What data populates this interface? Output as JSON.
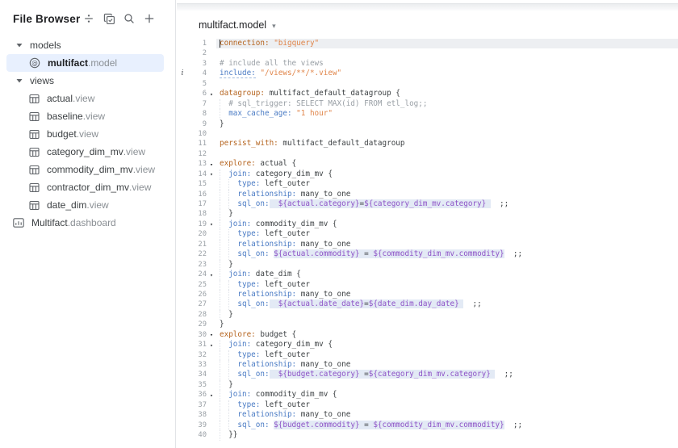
{
  "sidebar": {
    "title": "File Browser",
    "toolbar": [
      {
        "name": "collapse-all-icon"
      },
      {
        "name": "select-files-icon"
      },
      {
        "name": "search-icon"
      },
      {
        "name": "new-file-icon"
      }
    ],
    "tree": [
      {
        "kind": "folder",
        "label": "models",
        "expanded": true
      },
      {
        "kind": "model",
        "base": "multifact",
        "ext": ".model",
        "selected": true,
        "icon": "model-icon"
      },
      {
        "kind": "folder",
        "label": "views",
        "expanded": true
      },
      {
        "kind": "view",
        "base": "actual",
        "ext": ".view",
        "icon": "table-icon"
      },
      {
        "kind": "view",
        "base": "baseline",
        "ext": ".view",
        "icon": "table-icon"
      },
      {
        "kind": "view",
        "base": "budget",
        "ext": ".view",
        "icon": "table-icon"
      },
      {
        "kind": "view",
        "base": "category_dim_mv",
        "ext": ".view",
        "icon": "table-icon"
      },
      {
        "kind": "view",
        "base": "commodity_dim_mv",
        "ext": ".view",
        "icon": "table-icon"
      },
      {
        "kind": "view",
        "base": "contractor_dim_mv",
        "ext": ".view",
        "icon": "table-icon"
      },
      {
        "kind": "view",
        "base": "date_dim",
        "ext": ".view",
        "icon": "table-icon"
      },
      {
        "kind": "dashboard",
        "base": "Multifact",
        "ext": ".dashboard",
        "icon": "dashboard-icon"
      }
    ]
  },
  "editor": {
    "file_tab": {
      "label": "multifact.model",
      "dropdown_icon": "chevron-down-icon"
    },
    "current_line": 1,
    "gutter_annotations": [
      {
        "line": 4,
        "type": "info",
        "glyph": "i"
      }
    ],
    "lines": [
      {
        "n": 1,
        "hl": true,
        "cursor": true,
        "tok": [
          [
            "ko",
            "connection:"
          ],
          [
            "p",
            " "
          ],
          [
            "s",
            "\"bigquery\""
          ]
        ]
      },
      {
        "n": 2,
        "tok": []
      },
      {
        "n": 3,
        "tok": [
          [
            "c",
            "# include all the views"
          ]
        ]
      },
      {
        "n": 4,
        "ann": "i",
        "tok": [
          [
            "ki",
            "include:"
          ],
          [
            "p",
            " "
          ],
          [
            "s",
            "\"/views/**/*.view\""
          ]
        ]
      },
      {
        "n": 5,
        "tok": []
      },
      {
        "n": 6,
        "fold": true,
        "tok": [
          [
            "ko",
            "datagroup:"
          ],
          [
            "p",
            " multifact_default_datagroup {"
          ]
        ]
      },
      {
        "n": 7,
        "ind": 2,
        "tok": [
          [
            "c",
            "# sql_trigger: SELECT MAX(id) FROM etl_log;;"
          ]
        ]
      },
      {
        "n": 8,
        "ind": 2,
        "tok": [
          [
            "kb",
            "max_cache_age:"
          ],
          [
            "p",
            " "
          ],
          [
            "s",
            "\"1 hour\""
          ]
        ]
      },
      {
        "n": 9,
        "tok": [
          [
            "p",
            "}"
          ]
        ]
      },
      {
        "n": 10,
        "tok": []
      },
      {
        "n": 11,
        "tok": [
          [
            "ko",
            "persist_with:"
          ],
          [
            "p",
            " multifact_default_datagroup"
          ]
        ]
      },
      {
        "n": 12,
        "tok": []
      },
      {
        "n": 13,
        "fold": true,
        "tok": [
          [
            "ko",
            "explore:"
          ],
          [
            "p",
            " actual {"
          ]
        ]
      },
      {
        "n": 14,
        "ind": 2,
        "fold": true,
        "tok": [
          [
            "kb",
            "join:"
          ],
          [
            "p",
            " category_dim_mv {"
          ]
        ]
      },
      {
        "n": 15,
        "ind": 4,
        "tok": [
          [
            "kb",
            "type:"
          ],
          [
            "p",
            " left_outer"
          ]
        ]
      },
      {
        "n": 16,
        "ind": 4,
        "tok": [
          [
            "kb",
            "relationship:"
          ],
          [
            "p",
            " many_to_one"
          ]
        ]
      },
      {
        "n": 17,
        "ind": 4,
        "tok": [
          [
            "kb",
            "sql_on:"
          ],
          [
            "hp",
            "  "
          ],
          [
            "hv",
            "${actual.category}"
          ],
          [
            "hp",
            "="
          ],
          [
            "hv",
            "${category_dim_mv.category}"
          ],
          [
            "hp",
            " "
          ],
          [
            "p",
            "  ;;"
          ]
        ]
      },
      {
        "n": 18,
        "ind": 2,
        "tok": [
          [
            "p",
            "}"
          ]
        ]
      },
      {
        "n": 19,
        "ind": 2,
        "fold": true,
        "tok": [
          [
            "kb",
            "join:"
          ],
          [
            "p",
            " commodity_dim_mv {"
          ]
        ]
      },
      {
        "n": 20,
        "ind": 4,
        "tok": [
          [
            "kb",
            "type:"
          ],
          [
            "p",
            " left_outer"
          ]
        ]
      },
      {
        "n": 21,
        "ind": 4,
        "tok": [
          [
            "kb",
            "relationship:"
          ],
          [
            "p",
            " many_to_one"
          ]
        ]
      },
      {
        "n": 22,
        "ind": 4,
        "tok": [
          [
            "kb",
            "sql_on:"
          ],
          [
            "p",
            " "
          ],
          [
            "hv",
            "${actual.commodity}"
          ],
          [
            "hp",
            " = "
          ],
          [
            "hv",
            "${commodity_dim_mv.commodity}"
          ],
          [
            "p",
            "  ;;"
          ]
        ]
      },
      {
        "n": 23,
        "ind": 2,
        "tok": [
          [
            "p",
            "}"
          ]
        ]
      },
      {
        "n": 24,
        "ind": 2,
        "fold": true,
        "tok": [
          [
            "kb",
            "join:"
          ],
          [
            "p",
            " date_dim {"
          ]
        ]
      },
      {
        "n": 25,
        "ind": 4,
        "tok": [
          [
            "kb",
            "type:"
          ],
          [
            "p",
            " left_outer"
          ]
        ]
      },
      {
        "n": 26,
        "ind": 4,
        "tok": [
          [
            "kb",
            "relationship:"
          ],
          [
            "p",
            " many_to_one"
          ]
        ]
      },
      {
        "n": 27,
        "ind": 4,
        "tok": [
          [
            "kb",
            "sql_on:"
          ],
          [
            "hp",
            "  "
          ],
          [
            "hv",
            "${actual.date_date}"
          ],
          [
            "hp",
            "="
          ],
          [
            "hv",
            "${date_dim.day_date}"
          ],
          [
            "hp",
            " "
          ],
          [
            "p",
            "  ;;"
          ]
        ]
      },
      {
        "n": 28,
        "ind": 2,
        "tok": [
          [
            "p",
            "}"
          ]
        ]
      },
      {
        "n": 29,
        "tok": [
          [
            "p",
            "}"
          ]
        ]
      },
      {
        "n": 30,
        "fold": true,
        "tok": [
          [
            "ko",
            "explore:"
          ],
          [
            "p",
            " budget {"
          ]
        ]
      },
      {
        "n": 31,
        "ind": 2,
        "fold": true,
        "tok": [
          [
            "kb",
            "join:"
          ],
          [
            "p",
            " category_dim_mv {"
          ]
        ]
      },
      {
        "n": 32,
        "ind": 4,
        "tok": [
          [
            "kb",
            "type:"
          ],
          [
            "p",
            " left_outer"
          ]
        ]
      },
      {
        "n": 33,
        "ind": 4,
        "tok": [
          [
            "kb",
            "relationship:"
          ],
          [
            "p",
            " many_to_one"
          ]
        ]
      },
      {
        "n": 34,
        "ind": 4,
        "tok": [
          [
            "kb",
            "sql_on:"
          ],
          [
            "hp",
            "  "
          ],
          [
            "hv",
            "${budget.category}"
          ],
          [
            "hp",
            " ="
          ],
          [
            "hv",
            "${category_dim_mv.category}"
          ],
          [
            "hp",
            " "
          ],
          [
            "p",
            "  ;;"
          ]
        ]
      },
      {
        "n": 35,
        "ind": 2,
        "tok": [
          [
            "p",
            "}"
          ]
        ]
      },
      {
        "n": 36,
        "ind": 2,
        "fold": true,
        "tok": [
          [
            "kb",
            "join:"
          ],
          [
            "p",
            " commodity_dim_mv {"
          ]
        ]
      },
      {
        "n": 37,
        "ind": 4,
        "tok": [
          [
            "kb",
            "type:"
          ],
          [
            "p",
            " left_outer"
          ]
        ]
      },
      {
        "n": 38,
        "ind": 4,
        "tok": [
          [
            "kb",
            "relationship:"
          ],
          [
            "p",
            " many_to_one"
          ]
        ]
      },
      {
        "n": 39,
        "ind": 4,
        "tok": [
          [
            "kb",
            "sql_on:"
          ],
          [
            "p",
            " "
          ],
          [
            "hv",
            "${budget.commodity}"
          ],
          [
            "hp",
            " = "
          ],
          [
            "hv",
            "${commodity_dim_mv.commodity}"
          ],
          [
            "p",
            "  ;;"
          ]
        ]
      },
      {
        "n": 40,
        "ind": 2,
        "tok": [
          [
            "p",
            "}}"
          ]
        ]
      }
    ]
  },
  "colors": {
    "selected_item_bg": "#e8f0fe",
    "keyword_top_level": "#b5641f",
    "keyword_nested": "#4a7bc4",
    "string": "#e0854a",
    "comment": "#9aa0a6",
    "liquid_variable": "#8d53c7",
    "sql_highlight_bg": "#e3eaf5",
    "current_line_bg": "#edeff2",
    "icon_gray": "#5f6368"
  }
}
